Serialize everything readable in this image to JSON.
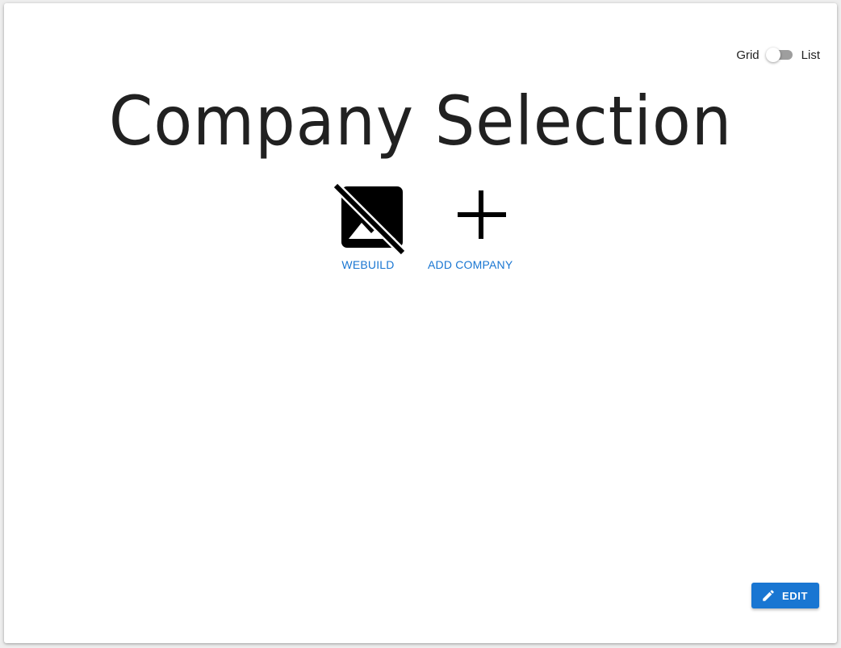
{
  "view_toggle": {
    "left_label": "Grid",
    "right_label": "List",
    "selected": "Grid"
  },
  "page": {
    "title": "Company Selection"
  },
  "companies": [
    {
      "label": "WEBUILD",
      "icon": "image-not-supported-icon"
    },
    {
      "label": "ADD COMPANY",
      "icon": "plus-icon"
    }
  ],
  "actions": {
    "edit_label": "EDIT",
    "edit_icon": "pencil-icon"
  },
  "colors": {
    "accent": "#1976d2",
    "text": "#212121",
    "switch_track": "#9e9e9e"
  }
}
